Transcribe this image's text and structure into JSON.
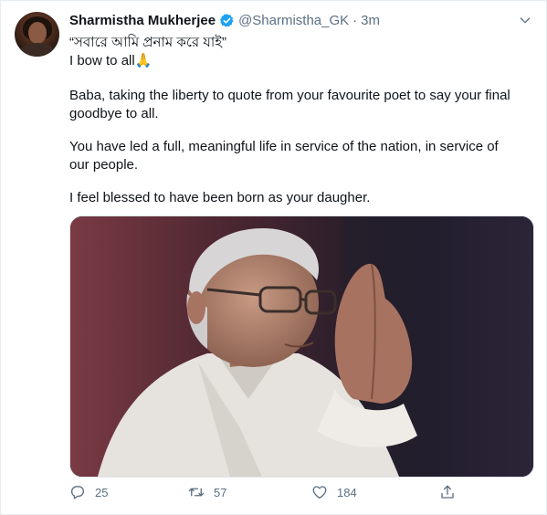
{
  "tweet": {
    "author": {
      "name": "Sharmistha Mukherjee",
      "handle": "@Sharmistha_GK",
      "separator": "·",
      "time": "3m"
    },
    "lines": [
      "“সবারে আমি প্রনাম করে যাই”",
      "I bow to all🙏",
      "Baba, taking the liberty to quote from your favourite poet to say your final",
      "goodbye to all.",
      "You have led a full, meaningful life in service of the nation, in service of",
      "our people.",
      "I feel blessed to have been born as your daugher."
    ],
    "actions": {
      "reply_count": "25",
      "retweet_count": "57",
      "like_count": "184"
    },
    "colors": {
      "text": "#0f1419",
      "secondary": "#5b7083",
      "verified": "#1da1f2",
      "border": "#e6ecf0"
    },
    "icons": [
      "verified-badge-icon",
      "chevron-down-icon",
      "reply-icon",
      "retweet-icon",
      "like-icon",
      "share-icon"
    ]
  }
}
